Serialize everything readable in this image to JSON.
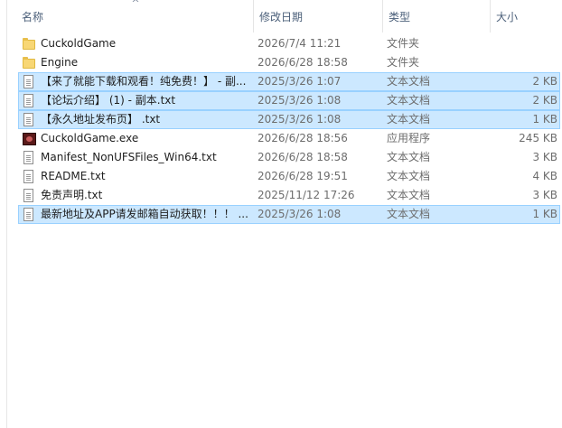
{
  "columns": {
    "name": "名称",
    "date": "修改日期",
    "type": "类型",
    "size": "大小"
  },
  "files": [
    {
      "icon": "folder-icon",
      "name": "CuckoldGame",
      "date": "2026/7/4 11:21",
      "type": "文件夹",
      "size": "",
      "selected": false
    },
    {
      "icon": "folder-icon",
      "name": "Engine",
      "date": "2026/6/28 18:58",
      "type": "文件夹",
      "size": "",
      "selected": false
    },
    {
      "icon": "text-document-icon",
      "name": "【来了就能下载和观看！纯免费！】 - 副...",
      "date": "2025/3/26 1:07",
      "type": "文本文档",
      "size": "2 KB",
      "selected": true
    },
    {
      "icon": "text-document-icon",
      "name": "【论坛介绍】 (1) - 副本.txt",
      "date": "2025/3/26 1:08",
      "type": "文本文档",
      "size": "2 KB",
      "selected": true
    },
    {
      "icon": "text-document-icon",
      "name": "【永久地址发布页】 .txt",
      "date": "2025/3/26 1:08",
      "type": "文本文档",
      "size": "1 KB",
      "selected": true
    },
    {
      "icon": "application-icon",
      "name": "CuckoldGame.exe",
      "date": "2026/6/28 18:56",
      "type": "应用程序",
      "size": "245 KB",
      "selected": false
    },
    {
      "icon": "text-document-icon",
      "name": "Manifest_NonUFSFiles_Win64.txt",
      "date": "2026/6/28 18:58",
      "type": "文本文档",
      "size": "3 KB",
      "selected": false
    },
    {
      "icon": "text-document-icon",
      "name": "README.txt",
      "date": "2026/6/28 19:51",
      "type": "文本文档",
      "size": "4 KB",
      "selected": false
    },
    {
      "icon": "text-document-icon",
      "name": "免责声明.txt",
      "date": "2025/11/12 17:26",
      "type": "文本文档",
      "size": "3 KB",
      "selected": false
    },
    {
      "icon": "text-document-icon",
      "name": "最新地址及APP请发邮箱自动获取！！！ ...",
      "date": "2025/3/26 1:08",
      "type": "文本文档",
      "size": "1 KB",
      "selected": true
    }
  ],
  "colors": {
    "selected_bg": "#cce8ff",
    "selected_border": "#99d1ff",
    "header_text": "#4c607a"
  },
  "sort_icon": "sort-up-icon"
}
